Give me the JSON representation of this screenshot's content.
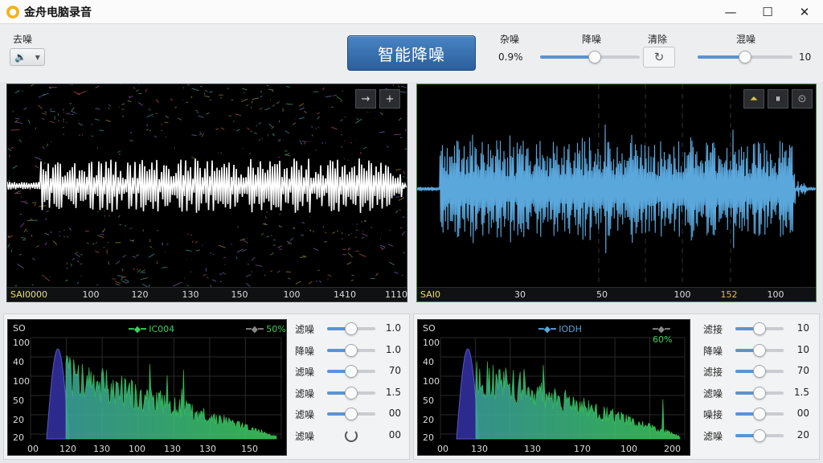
{
  "window": {
    "title": "金舟电脑录音",
    "minimize": "—",
    "maximize": "☐",
    "close": "✕"
  },
  "toolbar": {
    "left_label": "去噪",
    "dropdown_value": "🔉",
    "primary_button": "智能降噪",
    "c1": {
      "label": "杂噪",
      "value": "0.9%"
    },
    "c2": {
      "label": "降噪",
      "level": 0.55
    },
    "c3": {
      "label": "清除"
    },
    "c4": {
      "label": "混噪",
      "level": 0.5,
      "value": "10"
    }
  },
  "left_wave": {
    "axis": [
      "SAI0000",
      "100",
      "120",
      "130",
      "150",
      "100",
      "1410",
      "1110"
    ],
    "buttons": [
      "→",
      "+"
    ]
  },
  "right_wave": {
    "axis": [
      "SAI0",
      "30",
      "50",
      "100",
      "152",
      "100"
    ],
    "buttons": [
      "⏶",
      "⏸",
      "⏲"
    ]
  },
  "left_spectrum": {
    "title": "SO",
    "legend": [
      "IC004",
      "50%"
    ],
    "yticks": [
      "100",
      "40",
      "100",
      "50",
      "20",
      "20"
    ],
    "xticks": [
      "00",
      "120",
      "130",
      "100",
      "130",
      "130",
      "150"
    ],
    "colors": {
      "peak": "#2d2a8e",
      "main": "#3da9a2",
      "tail": "#3cd05a"
    }
  },
  "right_spectrum": {
    "title": "SO",
    "legend": [
      "IODH",
      "60%"
    ],
    "yticks": [
      "100",
      "40",
      "100",
      "50",
      "20",
      "20"
    ],
    "xticks": [
      "00",
      "130",
      "130",
      "170",
      "100",
      "200"
    ],
    "colors": {
      "peak": "#2d2a8e",
      "main": "#3da9a2",
      "tail": "#3cd05a"
    }
  },
  "left_controls": [
    {
      "label": "滤噪",
      "value": "1.0",
      "level": 0.5
    },
    {
      "label": "降噪",
      "value": "1.0",
      "level": 0.5
    },
    {
      "label": "滤噪",
      "value": "70",
      "level": 0.5
    },
    {
      "label": "滤噪",
      "value": "1.5",
      "level": 0.5
    },
    {
      "label": "滤噪",
      "value": "00",
      "level": 0.5
    },
    {
      "label": "滤噪",
      "value": "00",
      "level": null
    }
  ],
  "right_controls": [
    {
      "label": "滤接",
      "value": "10",
      "level": 0.5
    },
    {
      "label": "降噪",
      "value": "10",
      "level": 0.5
    },
    {
      "label": "滤接",
      "value": "70",
      "level": 0.5
    },
    {
      "label": "滤噪",
      "value": "1.5",
      "level": 0.5
    },
    {
      "label": "噪接",
      "value": "00",
      "level": 0.5
    },
    {
      "label": "滤噪",
      "value": "20",
      "level": 0.5
    }
  ],
  "colors": {
    "accent": "#5b93d3",
    "clean_wave": "#5aa7dc",
    "button": "#2a5f9c"
  }
}
